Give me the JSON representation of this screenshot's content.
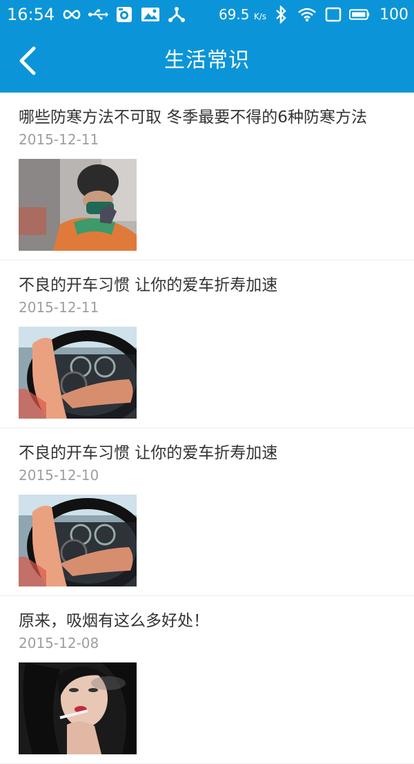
{
  "status_bar": {
    "time": "16:54",
    "network_speed": "69.5",
    "network_speed_unit": "K/s",
    "battery": "100",
    "icons": [
      "infinity-icon",
      "usb-icon",
      "app-icon",
      "image-icon",
      "share-icon",
      "bluetooth-icon",
      "wifi-icon",
      "screen-icon",
      "battery-icon"
    ]
  },
  "header": {
    "title": "生活常识",
    "back_icon": "chevron-left-icon"
  },
  "colors": {
    "primary": "#0b95d8",
    "title_text": "#333333",
    "date_text": "#9e9e9e",
    "divider": "#ececec"
  },
  "articles": [
    {
      "title": "哪些防寒方法不可取 冬季最要不得的6种防寒方法",
      "date": "2015-12-11",
      "thumbnail": "winter-cold-person-image"
    },
    {
      "title": "不良的开车习惯 让你的爱车折寿加速",
      "date": "2015-12-11",
      "thumbnail": "steering-wheel-image"
    },
    {
      "title": "不良的开车习惯 让你的爱车折寿加速",
      "date": "2015-12-10",
      "thumbnail": "steering-wheel-image"
    },
    {
      "title": "原来，吸烟有这么多好处！",
      "date": "2015-12-08",
      "thumbnail": "smoking-woman-image"
    }
  ]
}
